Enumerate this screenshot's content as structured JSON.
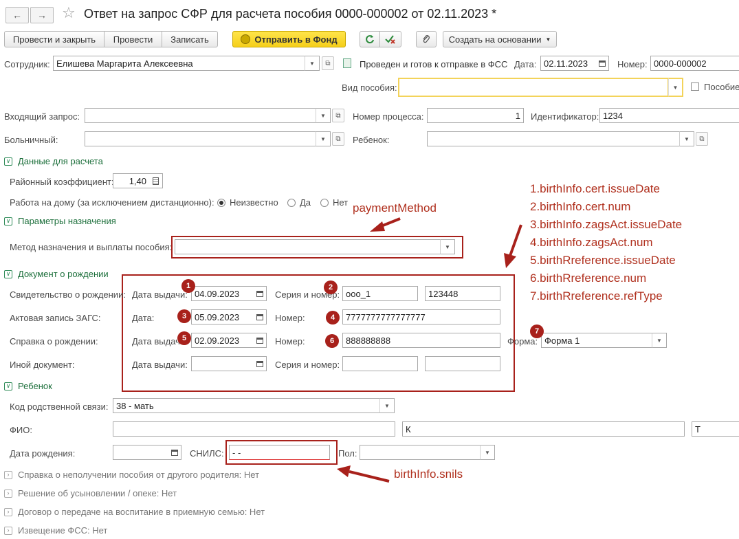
{
  "window": {
    "title": "Ответ на запрос СФР для расчета пособия 0000-000002 от 02.11.2023 *",
    "back": "←",
    "forward": "→",
    "star": "☆"
  },
  "toolbar": {
    "post_close": "Провести и закрыть",
    "post": "Провести",
    "save": "Записать",
    "send": "Отправить в Фонд",
    "create_based": "Создать на основании"
  },
  "header": {
    "employee_label": "Сотрудник:",
    "employee_value": "Елишева Маргарита Алексеевна",
    "status_text": "Проведен и готов к отправке в ФСС",
    "date_label": "Дата:",
    "date_value": "02.11.2023",
    "number_label": "Номер:",
    "number_value": "0000-000002",
    "benefit_type_label": "Вид пособия:",
    "benefit_type_value": "",
    "benefit_checkbox_label": "Пособие"
  },
  "request": {
    "incoming_label": "Входящий запрос:",
    "incoming_value": "",
    "process_label": "Номер процесса:",
    "process_value": "1",
    "identifier_label": "Идентификатор:",
    "identifier_value": "1234",
    "sick_label": "Больничный:",
    "sick_value": "",
    "child_label": "Ребенок:",
    "child_value": ""
  },
  "calc": {
    "section": "Данные для расчета",
    "coef_label": "Районный коэффициент:",
    "coef_value": "1,40",
    "home_label": "Работа на дому (за исключением дистанционно):",
    "radio_options": [
      "Неизвестно",
      "Да",
      "Нет"
    ],
    "radio_selected": "Неизвестно"
  },
  "assign": {
    "section": "Параметры назначения",
    "method_label": "Метод назначения и выплаты пособия:",
    "method_value": ""
  },
  "birthdoc": {
    "section": "Документ о рождении",
    "cert_label": "Свидетельство о рождении:",
    "cert_issue_label": "Дата выдачи:",
    "cert_issue_value": "04.09.2023",
    "cert_series_label": "Серия и номер:",
    "cert_series_value": "ооо_1",
    "cert_number_value": "123448",
    "zags_label": "Актовая запись ЗАГС:",
    "zags_date_label": "Дата:",
    "zags_date_value": "05.09.2023",
    "zags_num_label": "Номер:",
    "zags_num_value": "7777777777777777",
    "ref_label": "Справка о рождении:",
    "ref_issue_label": "Дата выдачи:",
    "ref_issue_value": "02.09.2023",
    "ref_num_label": "Номер:",
    "ref_num_value": "888888888",
    "ref_form_label": "Форма:",
    "ref_form_value": "Форма 1",
    "other_label": "Иной документ:",
    "other_issue_label": "Дата выдачи:",
    "other_issue_value": "",
    "other_series_label": "Серия и номер:",
    "other_series_value": "",
    "other_number_value": ""
  },
  "child": {
    "section": "Ребенок",
    "relation_label": "Код родственной связи:",
    "relation_value": "38 - мать",
    "fio_label": "ФИО:",
    "fio_last": "",
    "fio_first": "К",
    "fio_middle": "Т",
    "birth_label": "Дата рождения:",
    "birth_value": "",
    "snils_label": "СНИЛС:",
    "snils_value": "-   -",
    "sex_label": "Пол:",
    "sex_value": ""
  },
  "collapsed": [
    "Справка о неполучении пособия от другого родителя: Нет",
    "Решение об усыновлении / опеке: Нет",
    "Договор о передаче на воспитание в приемную семью: Нет",
    "Извещение ФСС: Нет"
  ],
  "annotations": {
    "payment_method": "paymentMethod",
    "snils": "birthInfo.snils",
    "list": [
      "1.birthInfo.cert.issueDate",
      "2.birthInfo.cert.num",
      "3.birthInfo.zagsAct.issueDate",
      "4.birthInfo.zagsAct.num",
      "5.birthRreference.issueDate",
      "6.birthRreference.num",
      "7.birthRreference.refType"
    ],
    "badges": [
      "1",
      "2",
      "3",
      "4",
      "5",
      "6",
      "7"
    ]
  },
  "colors": {
    "annotation": "#a8211b",
    "section": "#1c6f3b",
    "send_button": "#f5cf1a"
  }
}
